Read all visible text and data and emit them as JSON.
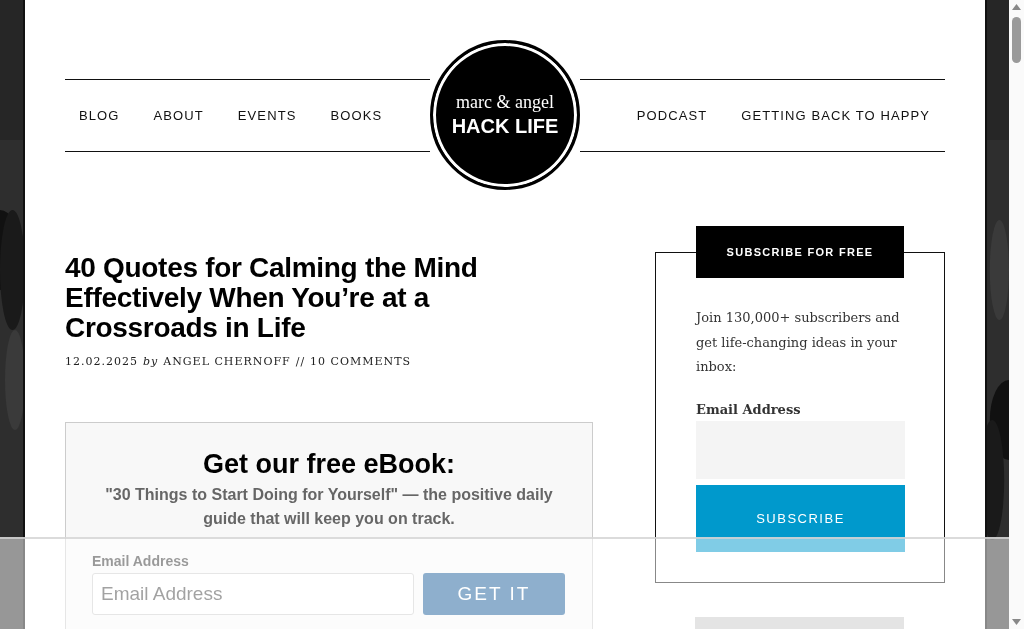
{
  "nav": {
    "left": [
      {
        "label": "BLOG"
      },
      {
        "label": "ABOUT"
      },
      {
        "label": "EVENTS"
      },
      {
        "label": "BOOKS"
      }
    ],
    "right": [
      {
        "label": "PODCAST"
      },
      {
        "label": "GETTING BACK TO HAPPY"
      }
    ]
  },
  "logo": {
    "line1": "marc & angel",
    "line2": "HACK LIFE"
  },
  "post": {
    "title": "40 Quotes for Calming the Mind Effectively When You’re at a Crossroads in Life",
    "date": "12.02.2025",
    "by": "by",
    "author": "ANGEL CHERNOFF",
    "separator": "//",
    "comments": "10 COMMENTS"
  },
  "ebook": {
    "heading": "Get our free eBook:",
    "description": "\"30 Things to Start Doing for Yourself\" — the positive daily guide that will keep you on track.",
    "email_label": "Email Address",
    "email_placeholder": "Email Address",
    "button": "GET IT"
  },
  "sidebar": {
    "heading": "SUBSCRIBE FOR FREE",
    "text": "Join 130,000+ subscribers and get life-changing ideas in your inbox:",
    "email_label": "Email Address",
    "button": "SUBSCRIBE"
  }
}
